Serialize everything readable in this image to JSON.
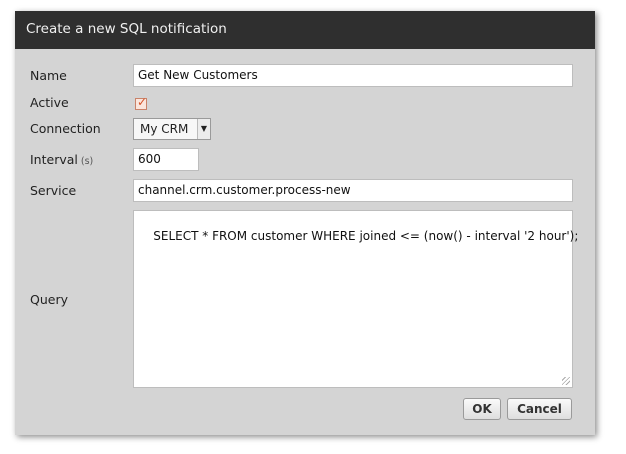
{
  "dialog": {
    "title": "Create a new SQL notification",
    "name": {
      "label": "Name",
      "value": "Get New Customers"
    },
    "active": {
      "label": "Active",
      "checked": true
    },
    "connection": {
      "label": "Connection",
      "value": "My CRM"
    },
    "interval": {
      "label": "Interval",
      "unit": "(s)",
      "value": "600"
    },
    "service": {
      "label": "Service",
      "value": "channel.crm.customer.process-new"
    },
    "query": {
      "label": "Query",
      "value": "SELECT * FROM customer WHERE joined <= (now() - interval '2 hour');"
    },
    "buttons": {
      "ok": "OK",
      "cancel": "Cancel"
    }
  }
}
